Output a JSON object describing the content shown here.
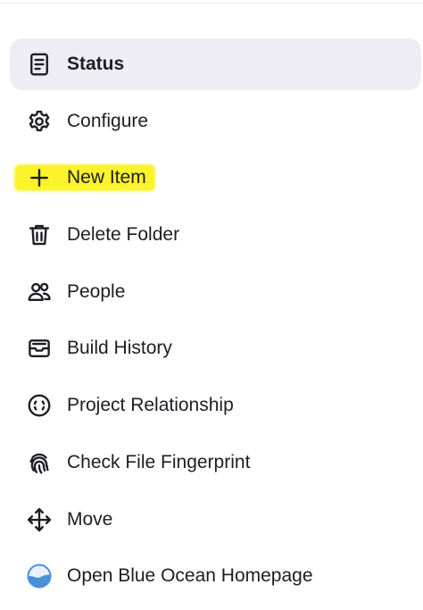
{
  "colors": {
    "active_background": "#ededf3",
    "text": "#1d1d24",
    "highlight": "#fbf21a",
    "blue_ocean": "#4a90d9"
  },
  "nav": {
    "items": [
      {
        "label": "Status",
        "icon": "notepad-icon",
        "active": true
      },
      {
        "label": "Configure",
        "icon": "gear-icon"
      },
      {
        "label": "New Item",
        "icon": "plus-icon",
        "highlighted": true
      },
      {
        "label": "Delete Folder",
        "icon": "trash-icon"
      },
      {
        "label": "People",
        "icon": "people-icon"
      },
      {
        "label": "Build History",
        "icon": "inbox-icon"
      },
      {
        "label": "Project Relationship",
        "icon": "circle-dashed-icon"
      },
      {
        "label": "Check File Fingerprint",
        "icon": "fingerprint-icon"
      },
      {
        "label": "Move",
        "icon": "move-arrows-icon"
      },
      {
        "label": "Open Blue Ocean Homepage",
        "icon": "blue-ocean-icon"
      }
    ]
  }
}
